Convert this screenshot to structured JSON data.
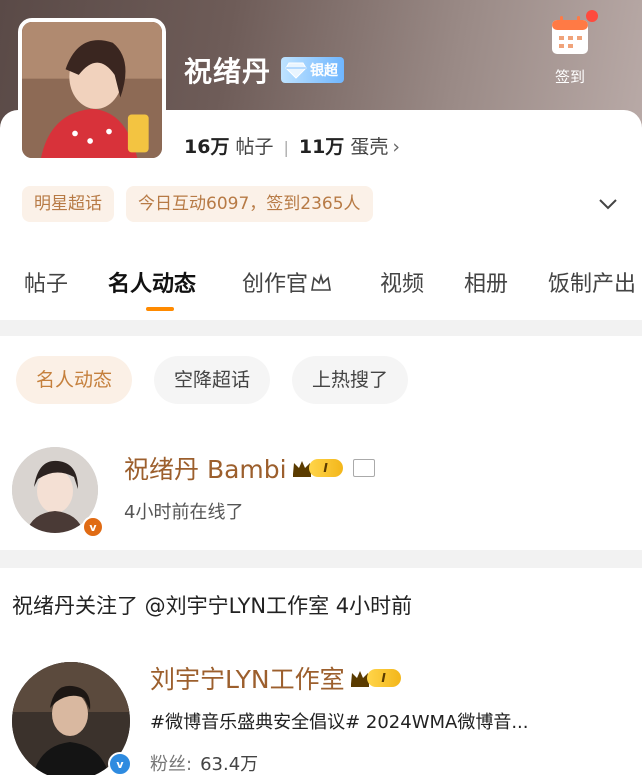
{
  "header": {
    "name": "祝绪丹",
    "badge_label": "银超",
    "checkin_label": "签到",
    "stats": {
      "posts_value": "16万",
      "posts_label": "帖子",
      "shells_value": "11万",
      "shells_label": "蛋壳",
      "chevron": "›"
    },
    "tags": [
      "明星超话",
      "今日互动6097，签到2365人"
    ]
  },
  "tabs": [
    "帖子",
    "名人动态",
    "创作官",
    "视频",
    "相册",
    "饭制产出"
  ],
  "active_tab": "名人动态",
  "chips": [
    "名人动态",
    "空降超话",
    "上热搜了"
  ],
  "celebrity": {
    "name": "祝绪丹 Bambi",
    "level": "I",
    "status": "4小时前在线了",
    "verified_mark": "v"
  },
  "activity": {
    "text": "祝绪丹关注了 @刘宇宁LYN工作室 4小时前",
    "followed": {
      "name": "刘宇宁LYN工作室",
      "level": "I",
      "description": "#微博音乐盛典安全倡议# 2024WMA微博音...",
      "fans_label": "粉丝:",
      "fans_value": "63.4万",
      "verified_mark": "v"
    }
  },
  "colors": {
    "accent_orange": "#ff8a00",
    "gold_text": "#9c5f2d",
    "tag_text": "#b77a45",
    "verified_blue": "#2e8be0",
    "verified_orange": "#e06b14"
  }
}
